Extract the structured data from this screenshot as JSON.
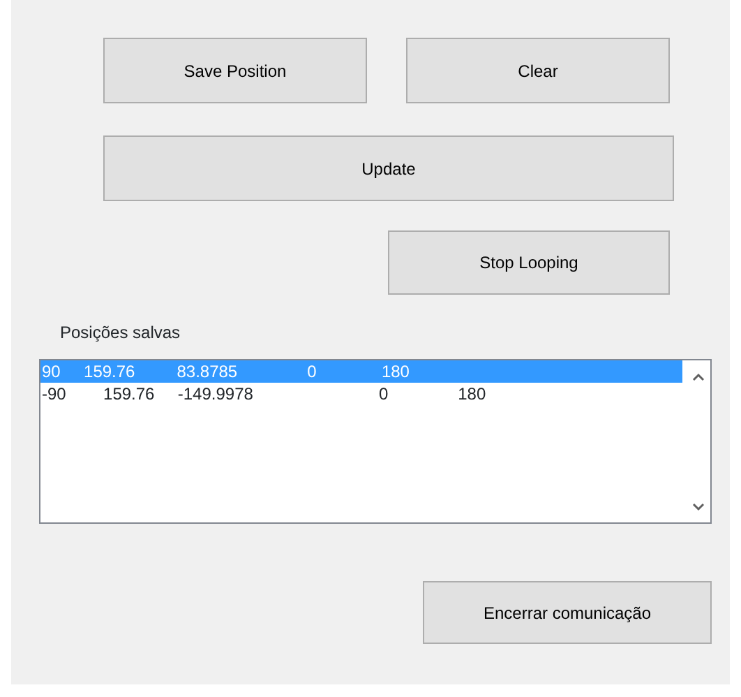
{
  "buttons": [
    {
      "label": "Save Position"
    },
    {
      "label": "Clear"
    },
    {
      "label": "Update"
    },
    {
      "label": "Stop Looping"
    }
  ],
  "saved_positions": {
    "label": "Posições salvas",
    "items": [
      {
        "text": "90     159.76         83.8785               0              180",
        "selected": true
      },
      {
        "text": "-90        159.76     -149.9978                           0               180",
        "selected": false
      }
    ]
  },
  "end_button": {
    "label": "Encerrar comunicação"
  }
}
